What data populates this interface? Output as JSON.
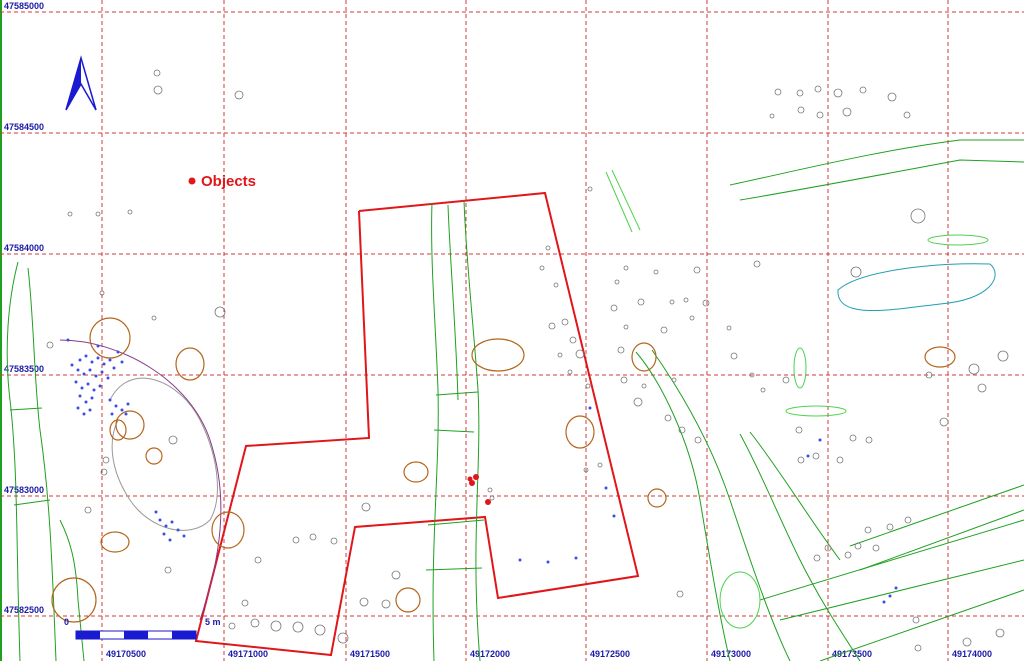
{
  "map": {
    "x_labels": [
      "49170500",
      "49171000",
      "49171500",
      "49172000",
      "49172500",
      "49173000",
      "49173500",
      "49174000"
    ],
    "y_labels": [
      "47585000",
      "47584500",
      "47584000",
      "47583500",
      "47583000",
      "47582500"
    ],
    "legend": {
      "label": "Objects"
    },
    "scale": {
      "start": "0",
      "end": "5 m"
    },
    "colors": {
      "grid": "#d23a3a",
      "survey_boundary": "#e0161a",
      "features_green": "#20a020",
      "features_light_green": "#50d050",
      "features_brown": "#b5651d",
      "features_teal": "#20a0b0",
      "points_blue": "#3a4ee8",
      "objects_red": "#e0161a",
      "north_arrow": "#1a1ad0",
      "labels": "#1a1aa8"
    }
  }
}
